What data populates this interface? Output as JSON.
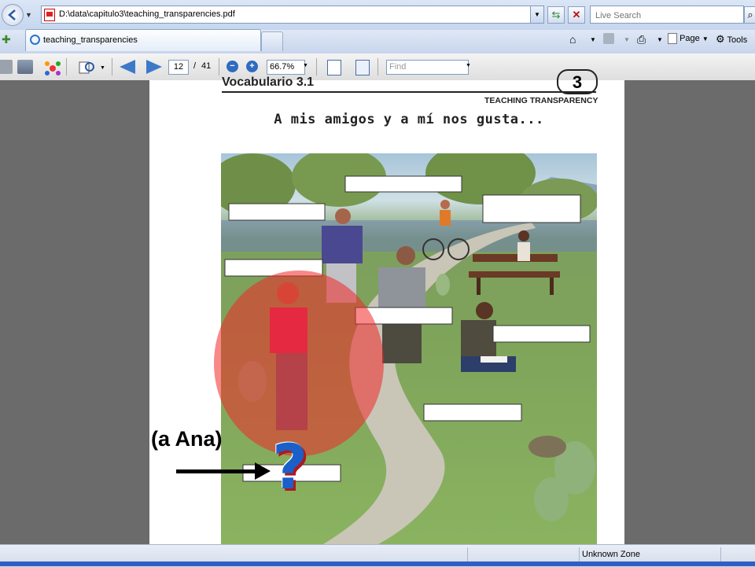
{
  "browser": {
    "address_url": "D:\\data\\capitulo3\\teaching_transparencies.pdf",
    "search_placeholder": "Live Search",
    "tab_title": "teaching_transparencies",
    "commands": {
      "page_label": "Page",
      "tools_label": "Tools"
    },
    "status_zone": "Unknown Zone"
  },
  "pdf_toolbar": {
    "current_page": "12",
    "page_separator": "/",
    "total_pages": "41",
    "zoom": "66.7%",
    "find_placeholder": "Find"
  },
  "document": {
    "section_title": "Vocabulario 3.1",
    "chapter_number": "3",
    "transparency_label": "TEACHING TRANSPARENCY",
    "subtitle": "A mis amigos y a mí nos gusta..."
  },
  "annotation": {
    "name_label": "(a Ana)",
    "question_mark": "?"
  },
  "colors": {
    "highlight_circle": "#f02828",
    "question_mark": "#1b5fc9",
    "question_shadow": "#b0181c"
  }
}
